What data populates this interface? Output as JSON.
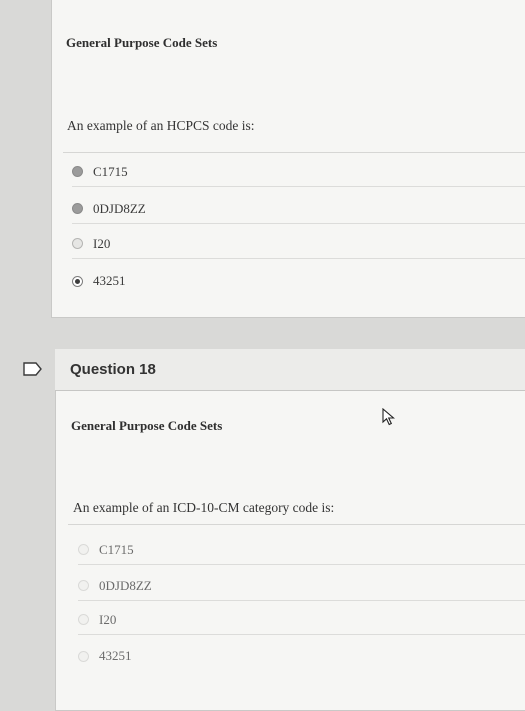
{
  "question17": {
    "section": "General Purpose Code Sets",
    "prompt": "An example of an HCPCS code is:",
    "options": [
      {
        "label": "C1715",
        "state": "filled"
      },
      {
        "label": "0DJD8ZZ",
        "state": "filled"
      },
      {
        "label": "I20",
        "state": "empty"
      },
      {
        "label": "43251",
        "state": "selected"
      }
    ]
  },
  "question18": {
    "heading": "Question 18",
    "section": "General Purpose Code Sets",
    "prompt": "An example of an ICD-10-CM category code is:",
    "options": [
      {
        "label": "C1715"
      },
      {
        "label": "0DJD8ZZ"
      },
      {
        "label": "I20"
      },
      {
        "label": "43251"
      }
    ]
  },
  "icons": {
    "flag": "flag-icon",
    "cursor": "mouse-cursor-icon"
  }
}
